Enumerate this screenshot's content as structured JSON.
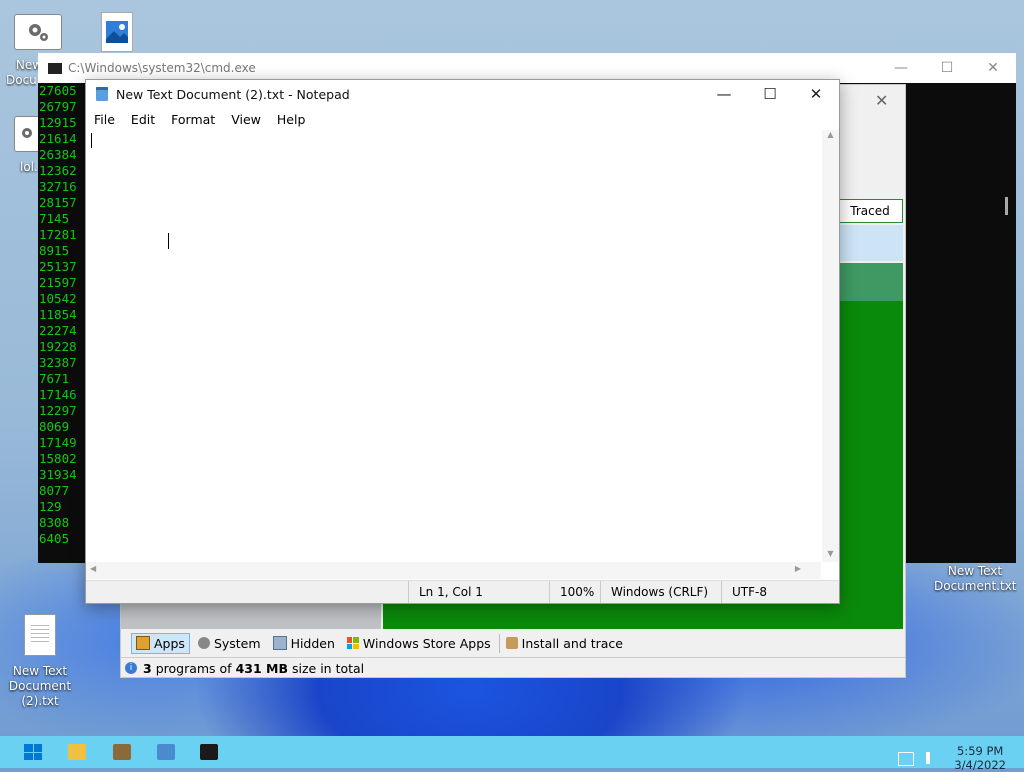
{
  "desktop": {
    "icons": [
      {
        "label": "New Text Document (2).txt"
      },
      {
        "label": "New Text Document.txt"
      },
      {
        "label_top": "New",
        "label_top2": "Docum"
      },
      {
        "label_mid": "lol."
      }
    ]
  },
  "cmd": {
    "title": "C:\\Windows\\system32\\cmd.exe",
    "lines": [
      "27605",
      "26797",
      "12915",
      "21614",
      "26384",
      "12362",
      "32716",
      "28157",
      "7145",
      "17281",
      "8915",
      "25137",
      "21597",
      "10542",
      "11854",
      "22274",
      "19228",
      "32387",
      "7671",
      "17146",
      "12297",
      "8069",
      "17149",
      "15802",
      "31934",
      "8077",
      "129",
      "8308",
      "6405"
    ]
  },
  "app": {
    "traced_header": "Traced",
    "tabs": [
      {
        "label": "Apps",
        "icon": "apps-icon",
        "selected": true
      },
      {
        "label": "System",
        "icon": "gear-icon"
      },
      {
        "label": "Hidden",
        "icon": "hidden-icon"
      },
      {
        "label": "Windows Store Apps",
        "icon": "windows-icon"
      },
      {
        "label": "Install and trace",
        "icon": "trace-icon"
      }
    ],
    "status": {
      "count": "3",
      "text1": "programs of",
      "size": "431 MB",
      "text2": "size in total"
    }
  },
  "notepad": {
    "title": "New Text Document (2).txt - Notepad",
    "menu": [
      "File",
      "Edit",
      "Format",
      "View",
      "Help"
    ],
    "status": {
      "position": "Ln 1, Col 1",
      "zoom": "100%",
      "line_ending": "Windows (CRLF)",
      "encoding": "UTF-8"
    }
  },
  "taskbar": {
    "time": "5:59 PM",
    "date": "3/4/2022"
  }
}
